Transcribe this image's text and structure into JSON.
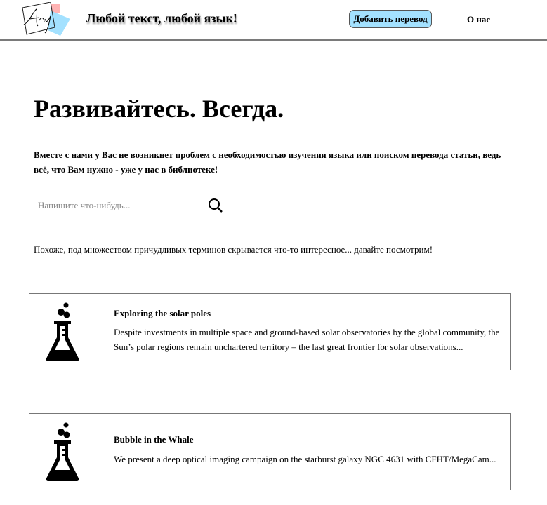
{
  "header": {
    "logo_text": "Any",
    "tagline": "Любой текст, любой язык!",
    "add_translation": "Добавить перевод",
    "about": "О нас"
  },
  "hero": {
    "title": "Развивайтесь. Всегда.",
    "lead": "Вместе с нами у Вас не возникнет проблем с необходимостью изучения языка или поиском перевода статьи, ведь всё, что Вам нужно - уже у нас в библиотеке!"
  },
  "search": {
    "placeholder": "Напишите что-нибудь...",
    "value": ""
  },
  "hint": "Похоже, под множеством причудливых терминов скрывается что-то интересное... давайте посмотрим!",
  "articles": [
    {
      "title": "Exploring the solar poles",
      "text": "Despite investments in multiple space and ground-based solar observatories by the global community, the Sun’s polar regions remain unchartered territory – the last great frontier for solar observations...",
      "icon": "flask-icon"
    },
    {
      "title": "Bubble in the Whale",
      "text": "We present a deep optical imaging campaign on the starburst galaxy NGC 4631 with CFHT/MegaCam...",
      "icon": "flask-icon"
    }
  ],
  "colors": {
    "button": "#a3e1ff",
    "logo_pink": "#ffb3b3",
    "logo_blue": "#a3e1ff"
  }
}
